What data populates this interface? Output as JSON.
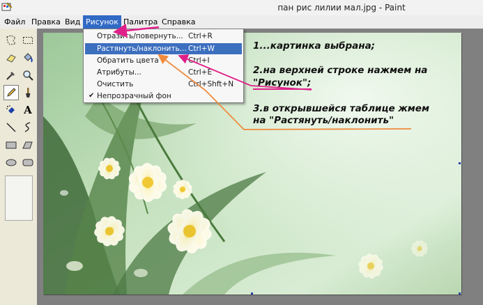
{
  "window": {
    "title": "пан рис лилии мал.jpg - Paint"
  },
  "menubar": {
    "items": [
      {
        "label": "Файл"
      },
      {
        "label": "Правка"
      },
      {
        "label": "Вид"
      },
      {
        "label": "Рисунок"
      },
      {
        "label": "Палитра"
      },
      {
        "label": "Справка"
      }
    ]
  },
  "image_menu": {
    "items": [
      {
        "label": "Отразить/повернуть...",
        "shortcut": "Ctrl+R"
      },
      {
        "label": "Растянуть/наклонить...",
        "shortcut": "Ctrl+W"
      },
      {
        "label": "Обратить цвета",
        "shortcut": "Ctrl+I"
      },
      {
        "label": "Атрибуты...",
        "shortcut": "Ctrl+E"
      },
      {
        "label": "Очистить",
        "shortcut": "Ctrl+Shft+N"
      },
      {
        "label": "Непрозрачный фон",
        "shortcut": "",
        "check": "✔"
      }
    ]
  },
  "tools": [
    {
      "name": "free-select-icon"
    },
    {
      "name": "rect-select-icon"
    },
    {
      "name": "eraser-icon"
    },
    {
      "name": "fill-bucket-icon"
    },
    {
      "name": "color-picker-icon"
    },
    {
      "name": "magnifier-icon"
    },
    {
      "name": "pencil-icon"
    },
    {
      "name": "brush-icon"
    },
    {
      "name": "airbrush-icon"
    },
    {
      "name": "text-icon",
      "glyph": "A"
    },
    {
      "name": "line-icon"
    },
    {
      "name": "curve-icon"
    },
    {
      "name": "rectangle-icon"
    },
    {
      "name": "polygon-icon"
    },
    {
      "name": "ellipse-icon"
    },
    {
      "name": "rounded-rect-icon"
    }
  ],
  "instructions": {
    "step1": "1...картинка выбрана;",
    "step2_line1": "2.на верхней строке нажмем на",
    "step2_line2": "\"Рисунок\";",
    "step3_line1": "3.в открывшейся таблице жмем",
    "step3_line2": "на \"Растянуть/наклонить\""
  },
  "colors": {
    "menu_highlight": "#316ac5",
    "pink_arrow": "#e0208a",
    "orange_arrow": "#f08a3c"
  }
}
